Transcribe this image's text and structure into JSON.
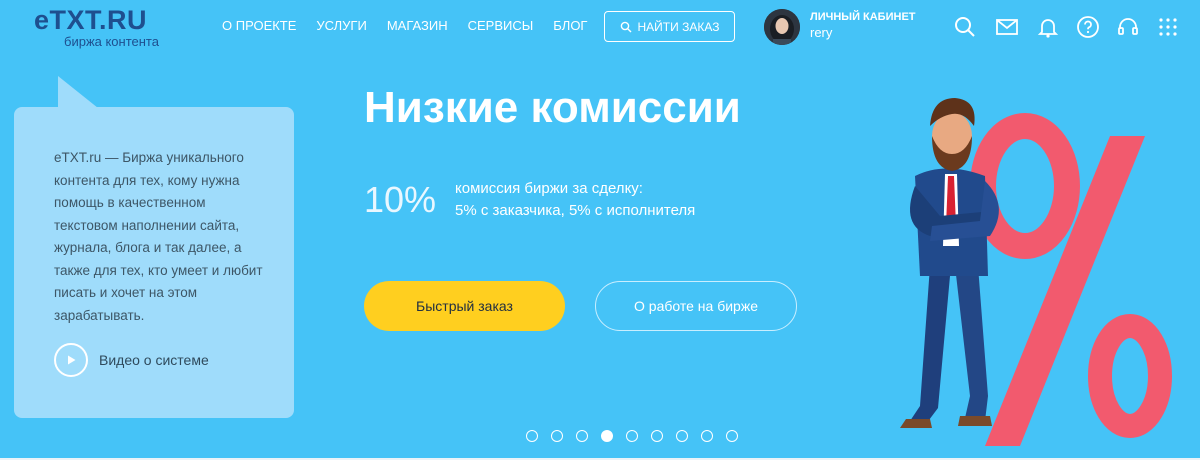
{
  "header": {
    "logo": "eTXT.RU",
    "logo_sub": "биржа контента",
    "nav": [
      {
        "label": "О проекте"
      },
      {
        "label": "Услуги"
      },
      {
        "label": "Магазин"
      },
      {
        "label": "Сервисы"
      },
      {
        "label": "Блог"
      }
    ],
    "find_order_label": "Найти заказ",
    "cabinet_title": "Личный кабинет",
    "username": "rery",
    "icons": [
      "search-icon",
      "mail-icon",
      "bell-icon",
      "help-icon",
      "headset-icon",
      "grid-icon"
    ]
  },
  "hero": {
    "bubble_text": "eTXT.ru — Биржа уникального контента для тех, кому нужна помощь в качественном текстовом наполнении сайта, журнала, блога и так далее, а также для тех, кто умеет и любит писать и хочет на этом зарабатывать.",
    "video_label": "Видео о системе",
    "title": "Низкие комиссии",
    "percent": "10%",
    "percent_line1": "комиссия биржи за сделку:",
    "percent_line2": "5% с заказчика, 5% с исполнителя",
    "primary_button": "Быстрый заказ",
    "secondary_button": "О работе на бирже",
    "slides_total": 9,
    "slide_active": 4
  },
  "colors": {
    "background": "#45c3f7",
    "bubble": "#9fdcfb",
    "logo": "#1e4f8f",
    "primary_button": "#ffcf1f",
    "percent_sign": "#f25a6e"
  }
}
